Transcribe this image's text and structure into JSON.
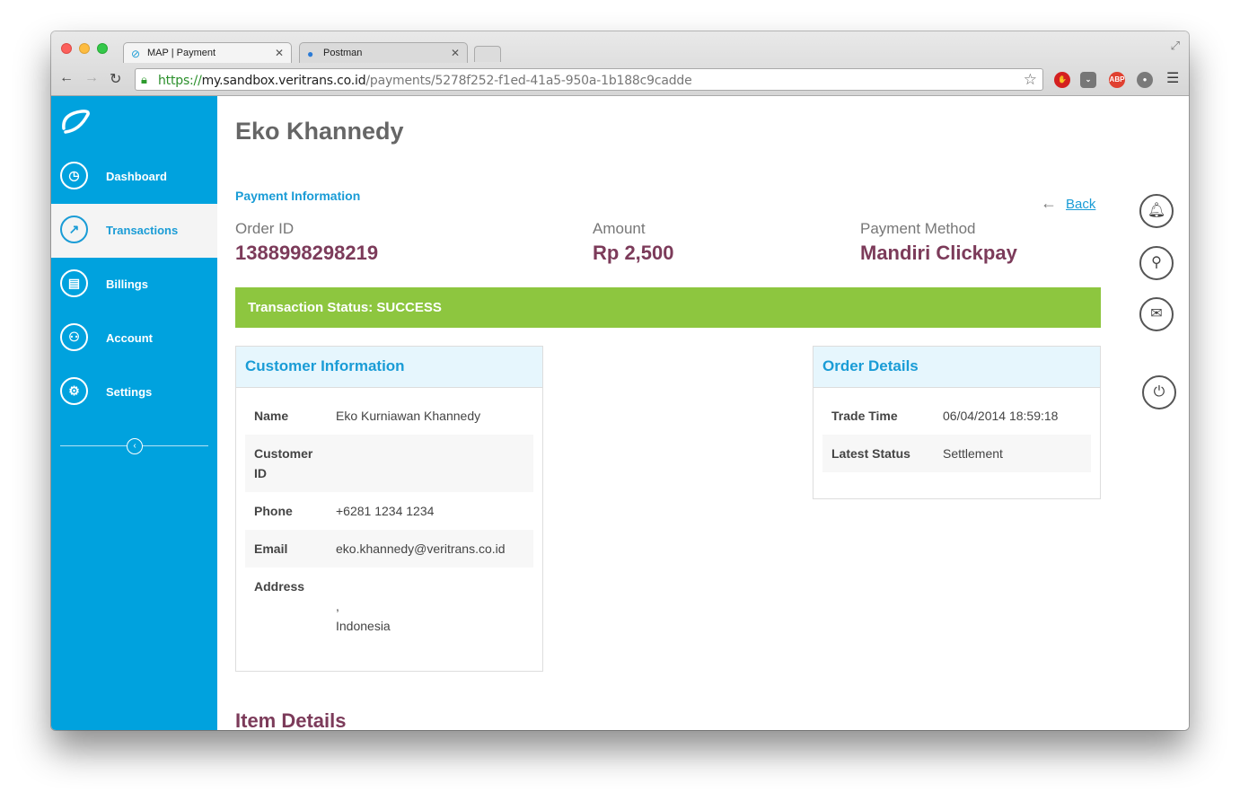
{
  "browser": {
    "tabs": [
      {
        "title": "MAP | Payment",
        "favicon": "veritrans-icon",
        "active": true
      },
      {
        "title": "Postman",
        "favicon": "globe-icon",
        "active": false
      }
    ],
    "url": {
      "scheme": "https://",
      "host": "my.sandbox.veritrans.co.id",
      "path": "/payments/5278f252-f1ed-41a5-950a-1b188c9cadde"
    },
    "extensions": {
      "abp": "ABP"
    }
  },
  "sidebar": {
    "items": [
      {
        "label": "Dashboard",
        "icon": "gauge-icon"
      },
      {
        "label": "Transactions",
        "icon": "trend-icon",
        "active": true
      },
      {
        "label": "Billings",
        "icon": "bill-icon"
      },
      {
        "label": "Account",
        "icon": "user-icon"
      },
      {
        "label": "Settings",
        "icon": "gear-icon"
      }
    ]
  },
  "page": {
    "title": "Eko Khannedy",
    "section_label": "Payment Information",
    "back_label": "Back"
  },
  "payment": {
    "order_id_label": "Order ID",
    "order_id": "1388998298219",
    "amount_label": "Amount",
    "amount": "Rp 2,500",
    "method_label": "Payment Method",
    "method": "Mandiri Clickpay"
  },
  "status": {
    "text": "Transaction Status: SUCCESS",
    "color": "#8dc63f"
  },
  "customer": {
    "heading": "Customer Information",
    "name_label": "Name",
    "name": "Eko Kurniawan Khannedy",
    "customer_id_label_1": "Customer",
    "customer_id_label_2": "ID",
    "customer_id": "",
    "phone_label": "Phone",
    "phone": "+6281 1234 1234",
    "email_label": "Email",
    "email": "eko.khannedy@veritrans.co.id",
    "address_label": "Address",
    "address_line1": ",",
    "address_line2": "Indonesia"
  },
  "order": {
    "heading": "Order Details",
    "trade_time_label": "Trade Time",
    "trade_time": "06/04/2014 18:59:18",
    "latest_status_label": "Latest Status",
    "latest_status": "Settlement"
  },
  "items": {
    "heading": "Item Details"
  },
  "colors": {
    "sidebar": "#00a2de",
    "accent": "#1a9cd6",
    "value": "#7c3b5a"
  }
}
